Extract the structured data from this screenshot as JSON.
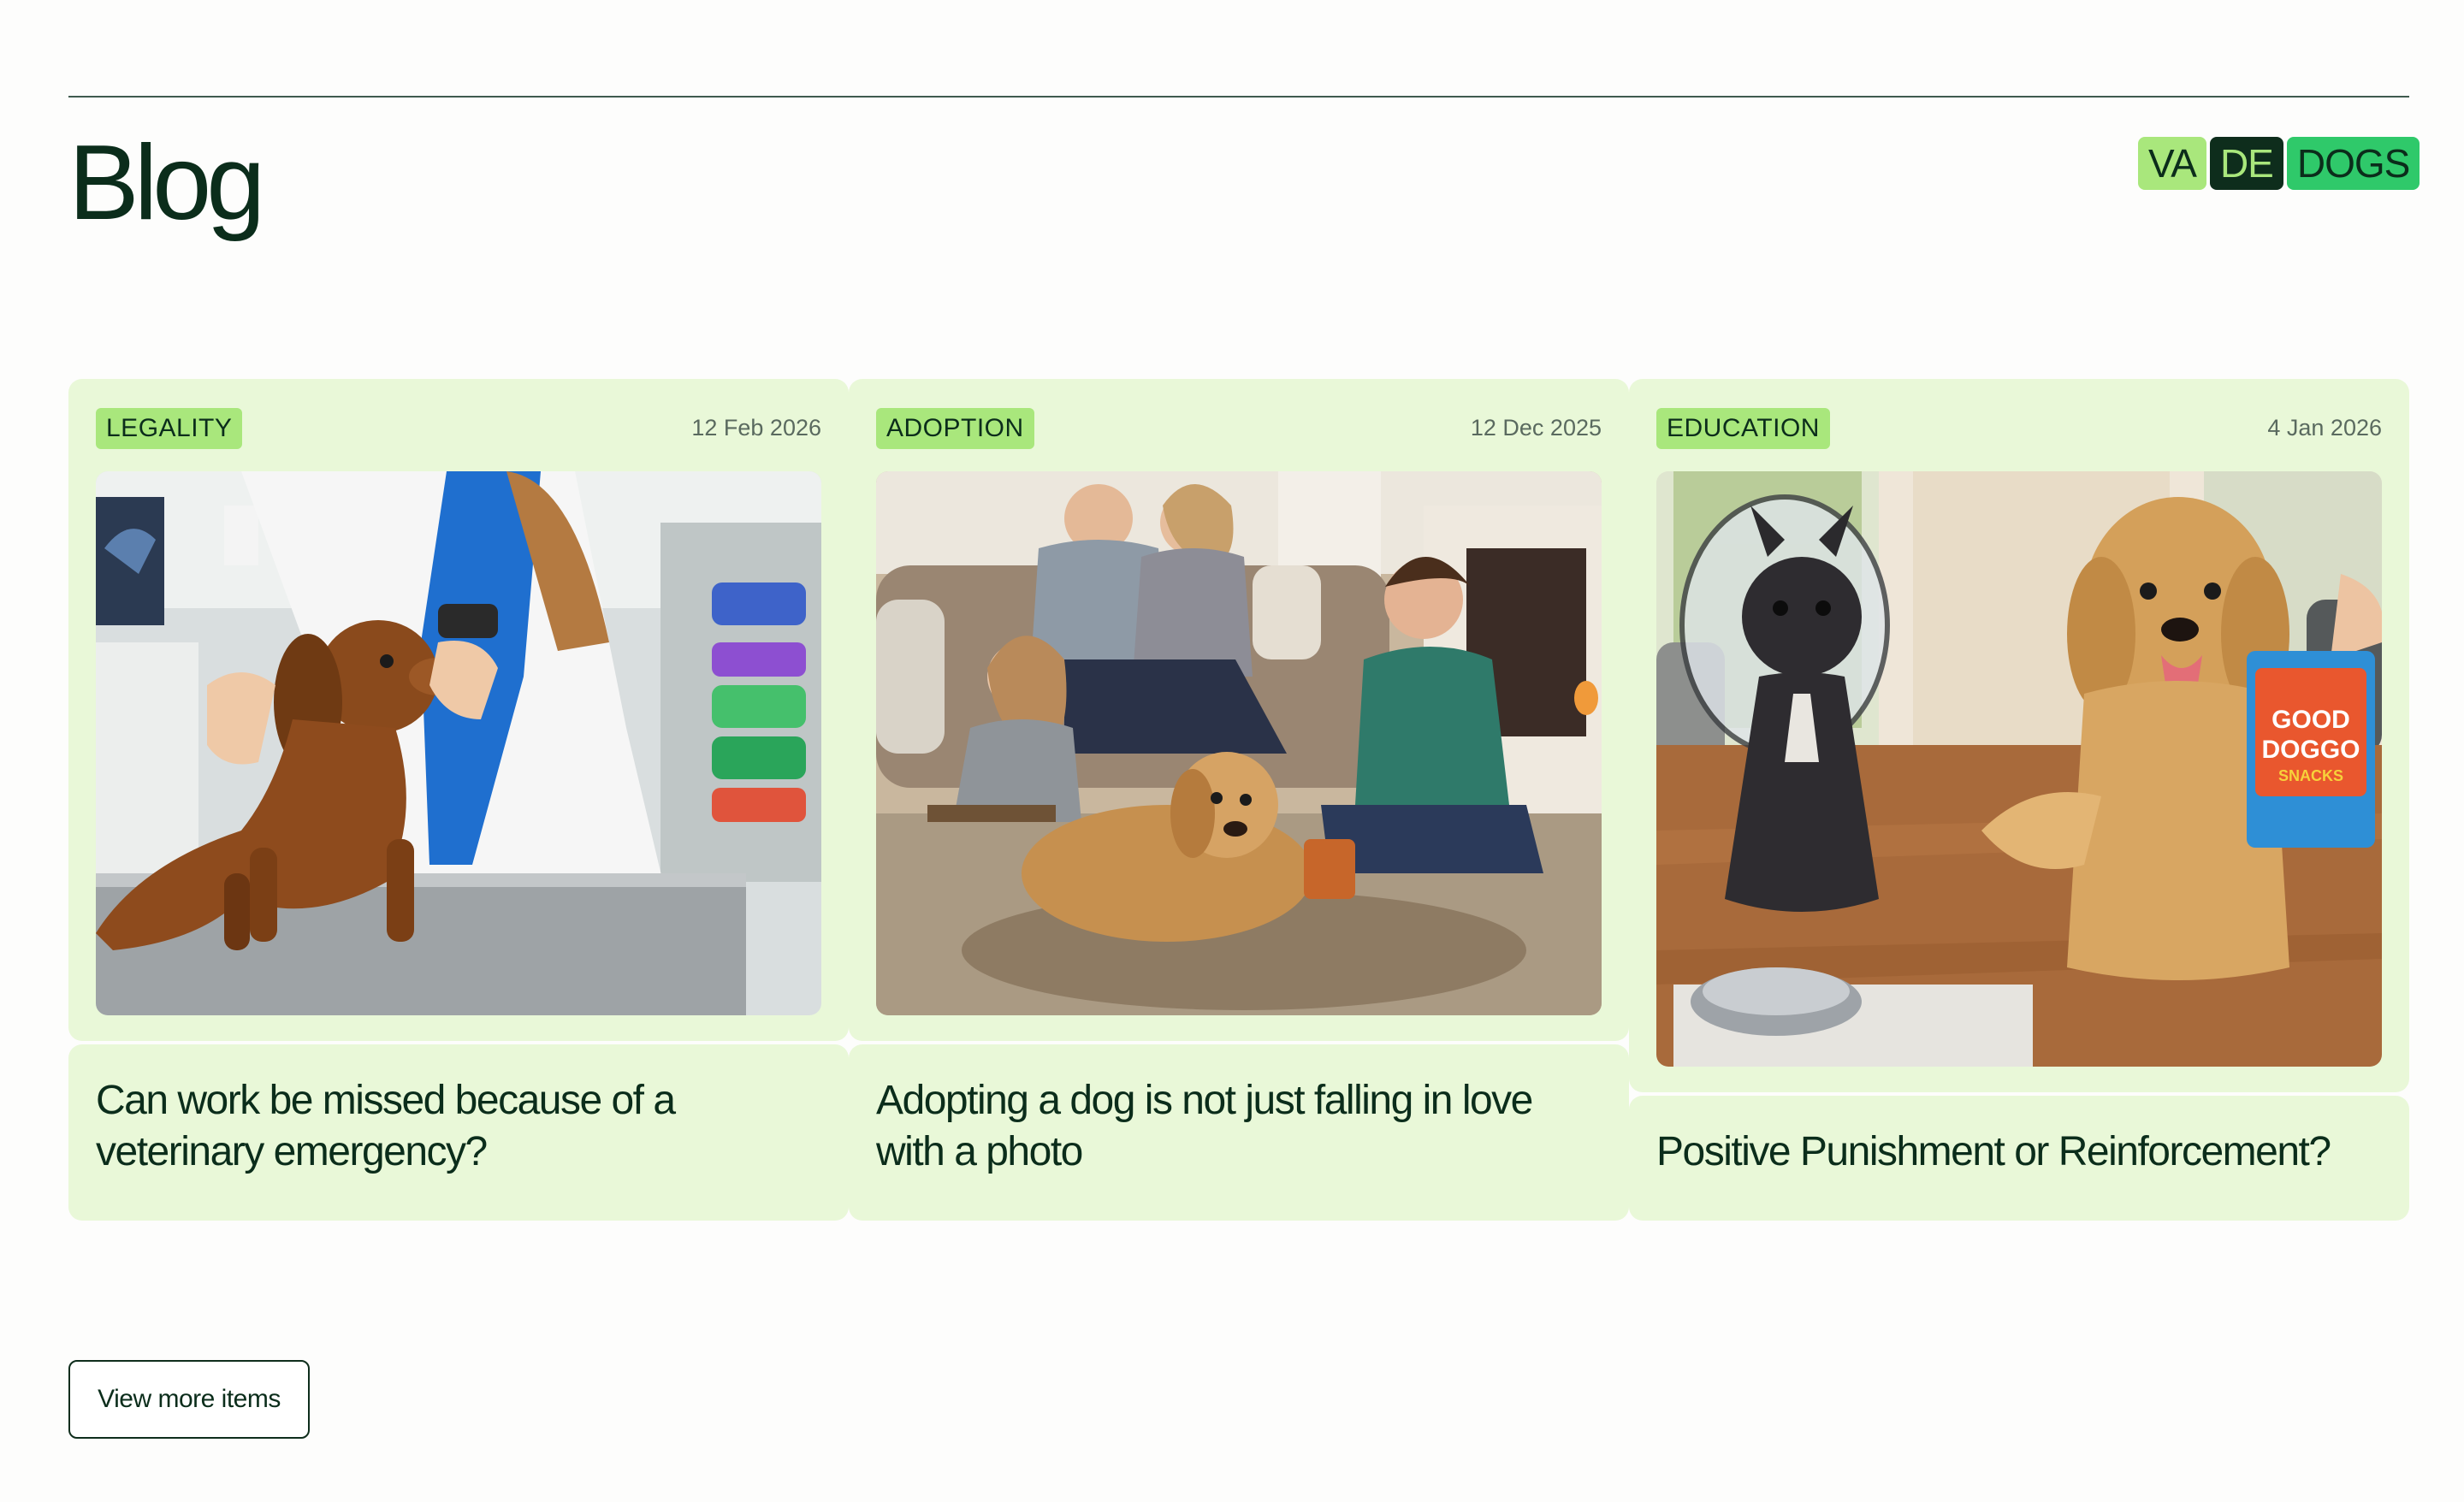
{
  "header": {
    "title": "Blog",
    "logo": [
      "VA",
      "DE",
      "DOGS"
    ]
  },
  "posts": [
    {
      "category": "LEGALITY",
      "date": "12 Feb 2026",
      "title": "Can work be missed because of a veterinary emergency?",
      "image": "dachshund-at-vet-photo"
    },
    {
      "category": "ADOPTION",
      "date": "12 Dec 2025",
      "title": "Adopting a dog is not just falling in love with a photo",
      "image": "family-with-golden-retriever-photo"
    },
    {
      "category": "EDUCATION",
      "date": "4 Jan 2026",
      "title": "Positive Punishment or Reinforcement?",
      "image": "french-bulldog-and-golden-retriever-photo",
      "snack_bag": "GOOD DOGGO SNACKS"
    }
  ],
  "actions": {
    "view_more_label": "View more items"
  },
  "colors": {
    "card_background": "#e9f8d8",
    "tag_background": "#a9e77c",
    "dark_green": "#0e2d1c",
    "brand_green": "#2fc96a"
  }
}
